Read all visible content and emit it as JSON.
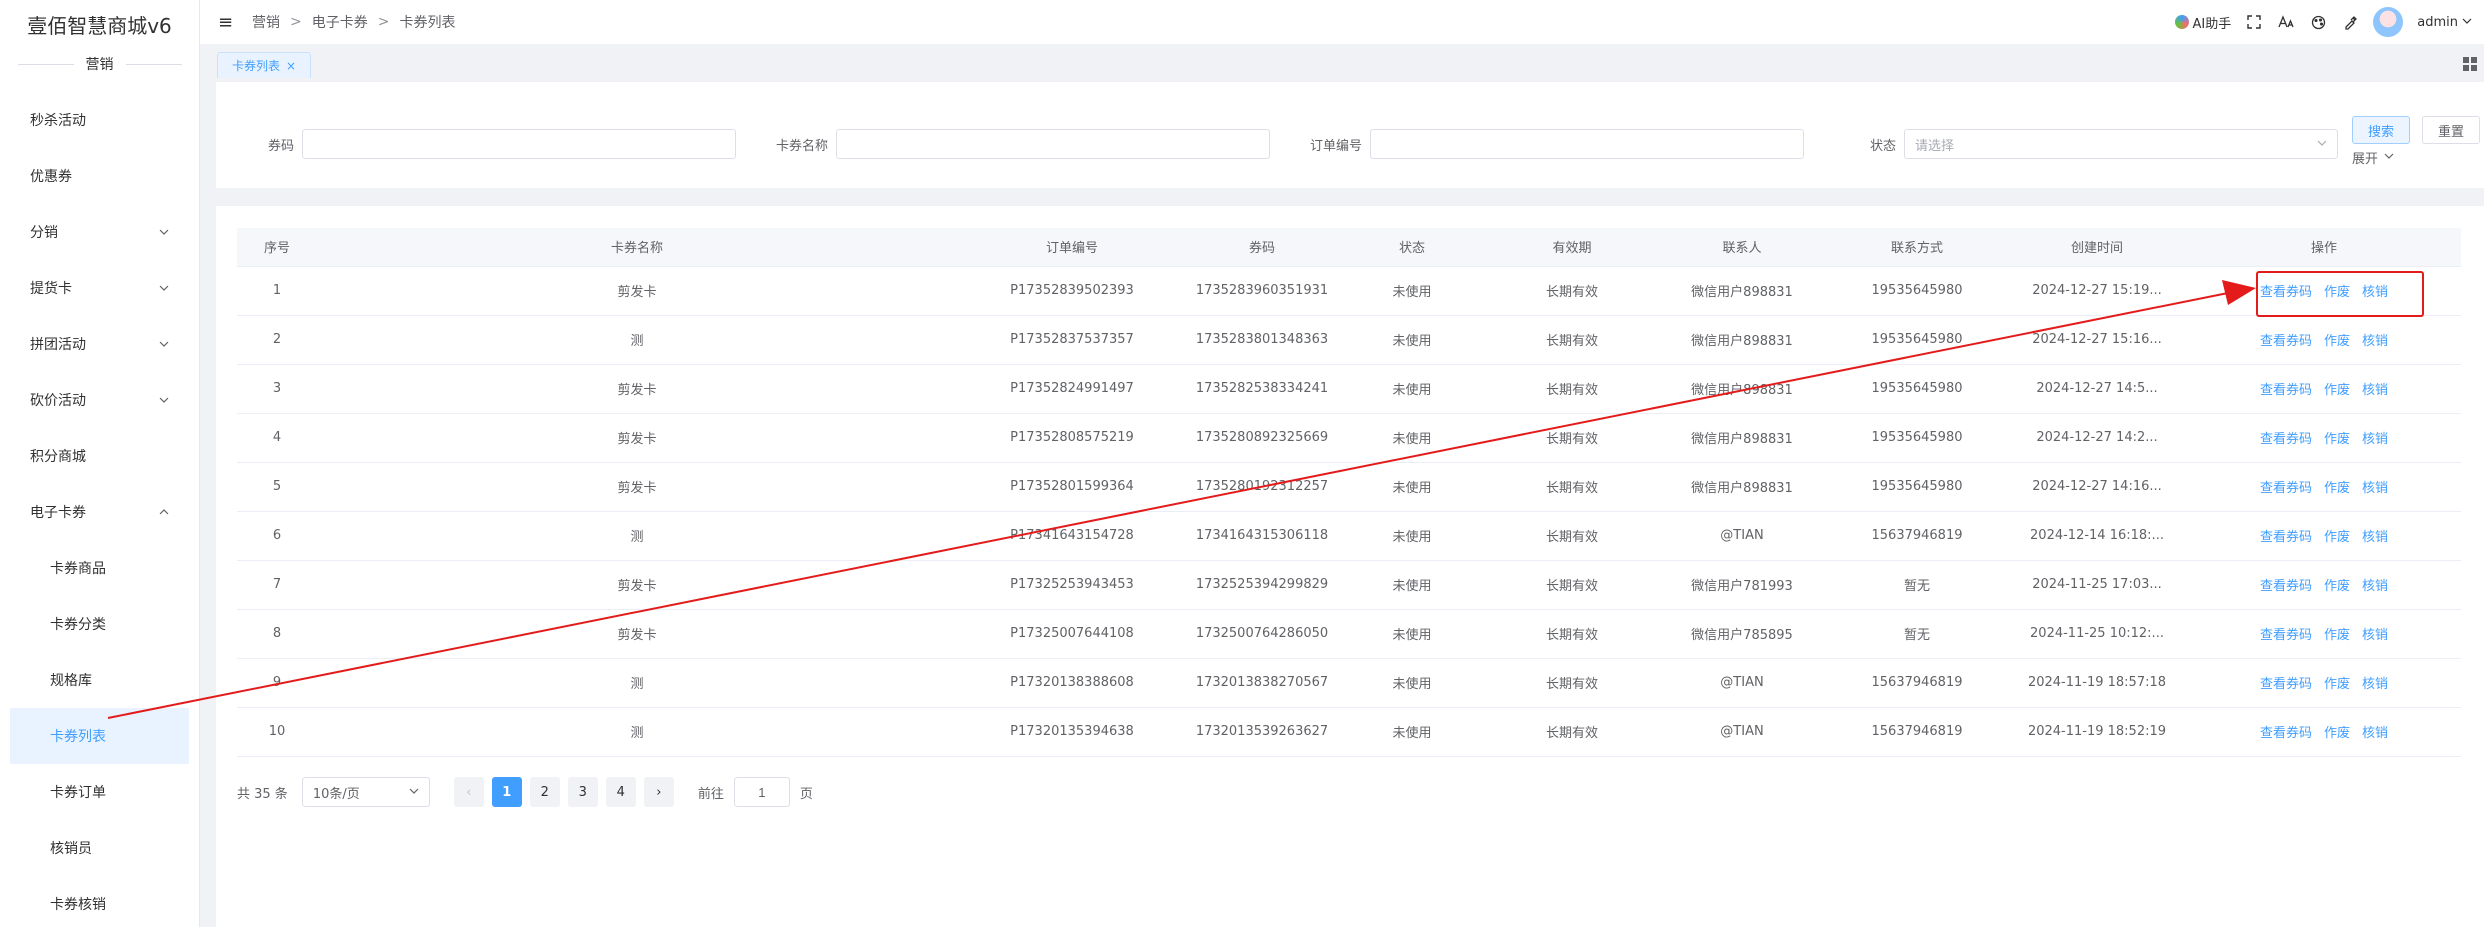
{
  "app": {
    "brand": "壹佰智慧商城v6"
  },
  "sidebar": {
    "section": "营销",
    "items": [
      {
        "label": "秒杀活动",
        "expandable": false
      },
      {
        "label": "优惠券",
        "expandable": false
      },
      {
        "label": "分销",
        "expandable": true
      },
      {
        "label": "提货卡",
        "expandable": true
      },
      {
        "label": "拼团活动",
        "expandable": true
      },
      {
        "label": "砍价活动",
        "expandable": true
      },
      {
        "label": "积分商城",
        "expandable": false
      },
      {
        "label": "电子卡券",
        "expandable": true,
        "expanded": true
      }
    ],
    "subitems": [
      {
        "label": "卡券商品"
      },
      {
        "label": "卡券分类"
      },
      {
        "label": "规格库"
      },
      {
        "label": "卡券列表",
        "active": true
      },
      {
        "label": "卡券订单"
      },
      {
        "label": "核销员"
      },
      {
        "label": "卡券核销"
      }
    ]
  },
  "header": {
    "breadcrumb": [
      "营销",
      "电子卡券",
      "卡券列表"
    ],
    "ai_label": "AI助手",
    "username": "admin"
  },
  "tabs": [
    {
      "label": "卡券列表",
      "close": "×"
    }
  ],
  "search": {
    "code_label": "券码",
    "name_label": "卡券名称",
    "order_label": "订单编号",
    "status_label": "状态",
    "status_placeholder": "请选择",
    "search_button": "搜索",
    "reset_button": "重置",
    "expand_label": "展开"
  },
  "table": {
    "columns": [
      "序号",
      "卡券名称",
      "订单编号",
      "券码",
      "状态",
      "有效期",
      "联系人",
      "联系方式",
      "创建时间",
      "操作"
    ],
    "actions": [
      "查看券码",
      "作废",
      "核销"
    ],
    "rows": [
      [
        "1",
        "剪发卡",
        "P17352839502393",
        "1735283960351931",
        "未使用",
        "长期有效",
        "微信用户898831",
        "19535645980",
        "2024-12-27 15:19..."
      ],
      [
        "2",
        "测",
        "P17352837537357",
        "1735283801348363",
        "未使用",
        "长期有效",
        "微信用户898831",
        "19535645980",
        "2024-12-27 15:16..."
      ],
      [
        "3",
        "剪发卡",
        "P17352824991497",
        "1735282538334241",
        "未使用",
        "长期有效",
        "微信用户898831",
        "19535645980",
        "2024-12-27 14:5..."
      ],
      [
        "4",
        "剪发卡",
        "P17352808575219",
        "1735280892325669",
        "未使用",
        "长期有效",
        "微信用户898831",
        "19535645980",
        "2024-12-27 14:2..."
      ],
      [
        "5",
        "剪发卡",
        "P17352801599364",
        "1735280192312257",
        "未使用",
        "长期有效",
        "微信用户898831",
        "19535645980",
        "2024-12-27 14:16..."
      ],
      [
        "6",
        "测",
        "P17341643154728",
        "1734164315306118",
        "未使用",
        "长期有效",
        "@TIAN",
        "15637946819",
        "2024-12-14 16:18:..."
      ],
      [
        "7",
        "剪发卡",
        "P17325253943453",
        "1732525394299829",
        "未使用",
        "长期有效",
        "微信用户781993",
        "暂无",
        "2024-11-25 17:03..."
      ],
      [
        "8",
        "剪发卡",
        "P17325007644108",
        "1732500764286050",
        "未使用",
        "长期有效",
        "微信用户785895",
        "暂无",
        "2024-11-25 10:12:..."
      ],
      [
        "9",
        "测",
        "P17320138388608",
        "1732013838270567",
        "未使用",
        "长期有效",
        "@TIAN",
        "15637946819",
        "2024-11-19 18:57:18"
      ],
      [
        "10",
        "测",
        "P17320135394638",
        "1732013539263627",
        "未使用",
        "长期有效",
        "@TIAN",
        "15637946819",
        "2024-11-19 18:52:19"
      ]
    ]
  },
  "pagination": {
    "total": "共 35 条",
    "page_size": "10条/页",
    "pages": [
      "1",
      "2",
      "3",
      "4"
    ],
    "current": "1",
    "goto_prefix": "前往",
    "goto_value": "1",
    "goto_suffix": "页"
  },
  "annotation": {
    "color": "#e31b1b"
  }
}
